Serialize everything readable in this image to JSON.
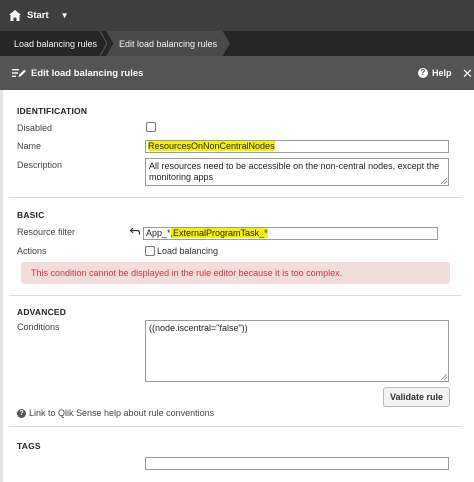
{
  "topbar": {
    "start_label": "Start"
  },
  "breadcrumbs": {
    "item1": "Load balancing rules",
    "item2": "Edit load balancing rules"
  },
  "panel": {
    "title": "Edit load balancing rules",
    "help_label": "Help"
  },
  "identification": {
    "heading": "IDENTIFICATION",
    "disabled_label": "Disabled",
    "name_label": "Name",
    "name_value": "ResourcesOnNonCentralNodes",
    "description_label": "Description",
    "description_value": "All resources need to be accessible on the non-central nodes, except the monitoring apps"
  },
  "basic": {
    "heading": "BASIC",
    "resource_filter_label": "Resource filter",
    "resource_filter_value_a": "App_*",
    "resource_filter_value_b": ",ExternalProgramTask_*",
    "actions_label": "Actions",
    "load_balancing_label": "Load balancing",
    "error_text": "This condition cannot be displayed in the rule editor because it is too complex."
  },
  "advanced": {
    "heading": "ADVANCED",
    "conditions_label": "Conditions",
    "conditions_value": "((node.iscentral=\"false\"))",
    "validate_label": "Validate rule",
    "help_link": "Link to Qlik Sense help about rule conventions"
  },
  "tags": {
    "heading": "TAGS"
  },
  "colors": {
    "highlight": "#f6f200",
    "error_text": "#c0393b",
    "error_bg": "#f2dcdc"
  }
}
